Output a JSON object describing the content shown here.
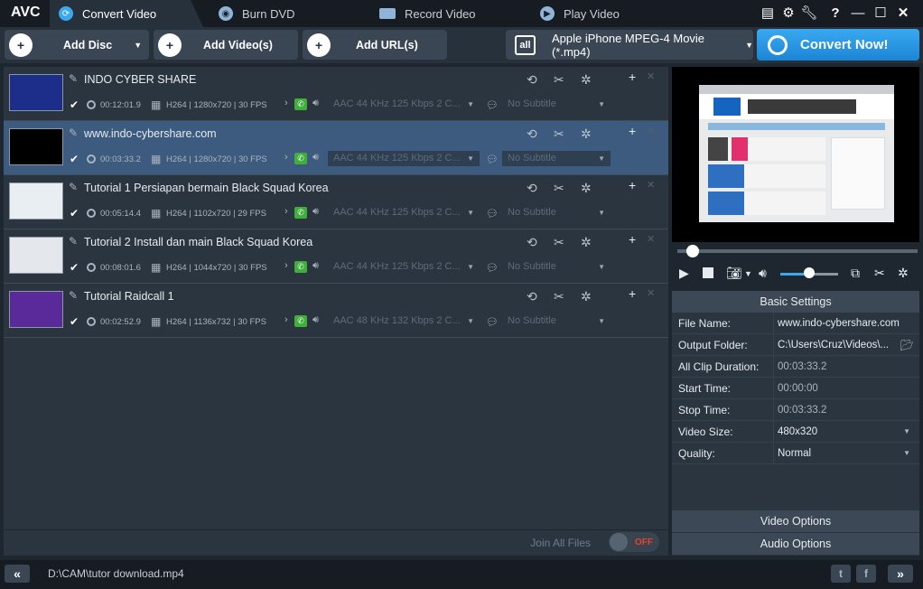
{
  "app": {
    "logo": "AVC"
  },
  "tabs": [
    {
      "label": "Convert Video",
      "active": true
    },
    {
      "label": "Burn DVD",
      "active": false
    },
    {
      "label": "Record Video",
      "active": false
    },
    {
      "label": "Play Video",
      "active": false
    }
  ],
  "window_icons": [
    "list-icon",
    "gear-icon",
    "wrench-icon",
    "help-icon",
    "minimize-icon",
    "maximize-icon",
    "close-icon"
  ],
  "toolbar": {
    "add_disc": "Add Disc",
    "add_videos": "Add Video(s)",
    "add_urls": "Add URL(s)",
    "format_icon_text": "all",
    "format": "Apple iPhone MPEG-4 Movie (*.mp4)",
    "convert": "Convert Now!"
  },
  "files": [
    {
      "title": "INDO CYBER SHARE",
      "duration": "00:12:01.9",
      "video": "H264 | 1280x720 | 30 FPS",
      "audio": "AAC 44 KHz 125 Kbps 2 C...",
      "subtitle": "No Subtitle",
      "selected": false,
      "thumb_color": "#1c2d8a"
    },
    {
      "title": "www.indo-cybershare.com",
      "duration": "00:03:33.2",
      "video": "H264 | 1280x720 | 30 FPS",
      "audio": "AAC 44 KHz 125 Kbps 2 C...",
      "subtitle": "No Subtitle",
      "selected": true,
      "thumb_color": "#000000"
    },
    {
      "title": "Tutorial 1 Persiapan bermain Black Squad Korea",
      "duration": "00:05:14.4",
      "video": "H264 | 1102x720 | 29 FPS",
      "audio": "AAC 44 KHz 125 Kbps 2 C...",
      "subtitle": "No Subtitle",
      "selected": false,
      "thumb_color": "#e9eef3"
    },
    {
      "title": "Tutorial 2 Install dan main Black Squad Korea",
      "duration": "00:08:01.6",
      "video": "H264 | 1044x720 | 30 FPS",
      "audio": "AAC 44 KHz 125 Kbps 2 C...",
      "subtitle": "No Subtitle",
      "selected": false,
      "thumb_color": "#e4e8ec"
    },
    {
      "title": "Tutorial Raidcall 1",
      "duration": "00:02:52.9",
      "video": "H264 | 1136x732 | 30 FPS",
      "audio": "AAC 48 KHz 132 Kbps 2 C...",
      "subtitle": "No Subtitle",
      "selected": false,
      "thumb_color": "#5a2a9a"
    }
  ],
  "join": {
    "label": "Join All Files",
    "state": "OFF"
  },
  "settings": {
    "header": "Basic Settings",
    "rows": [
      {
        "label": "File Name:",
        "value": "www.indo-cybershare.com"
      },
      {
        "label": "Output Folder:",
        "value": "C:\\Users\\Cruz\\Videos\\..."
      },
      {
        "label": "All Clip Duration:",
        "value": "00:03:33.2"
      },
      {
        "label": "Start Time:",
        "value": "00:00:00"
      },
      {
        "label": "Stop Time:",
        "value": "00:03:33.2"
      },
      {
        "label": "Video Size:",
        "value": "480x320"
      },
      {
        "label": "Quality:",
        "value": "Normal"
      }
    ],
    "video_options": "Video Options",
    "audio_options": "Audio Options"
  },
  "player": {
    "seek_position": 0.03,
    "volume": 0.5
  },
  "status": {
    "path": "D:\\CAM\\tutor download.mp4"
  },
  "colors": {
    "accent": "#2a97e4",
    "selected_row": "#3c5b7e",
    "toggle_off": "#e0452f"
  }
}
